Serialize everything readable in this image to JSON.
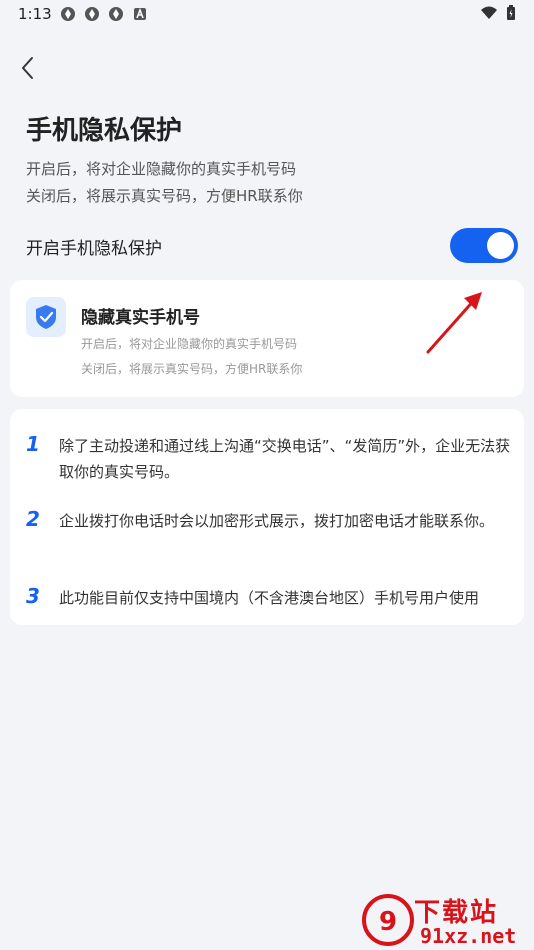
{
  "status_bar": {
    "time": "1:13",
    "icons": [
      "app-notification-icon",
      "app-notification-icon",
      "app-notification-icon",
      "a-badge-icon"
    ],
    "right_icons": [
      "wifi-icon",
      "battery-icon"
    ]
  },
  "header": {
    "back_icon": "chevron-left-icon",
    "title": "手机隐私保护"
  },
  "description": {
    "line1": "开启后，将对企业隐藏你的真实手机号码",
    "line2": "关闭后，将展示真实号码，方便HR联系你"
  },
  "toggle": {
    "label": "开启手机隐私保护",
    "state": "on",
    "color": "#1561f0"
  },
  "info_card": {
    "icon": "shield-check-icon",
    "title": "隐藏真实手机号",
    "desc1": "开启后，将对企业隐藏你的真实手机号码",
    "desc2": "关闭后，将展示真实号码，方便HR联系你"
  },
  "rules": [
    {
      "num": "1",
      "text": "除了主动投递和通过线上沟通“交换电话”、“发简历”外，企业无法获取你的真实号码。"
    },
    {
      "num": "2",
      "text": "企业拨打你电话时会以加密形式展示，拨打加密电话才能联系你。"
    },
    {
      "num": "3",
      "text": "此功能目前仅支持中国境内（不含港澳台地区）手机号用户使用"
    }
  ],
  "watermark": {
    "top": "下载站",
    "bottom": "91xz.net"
  }
}
